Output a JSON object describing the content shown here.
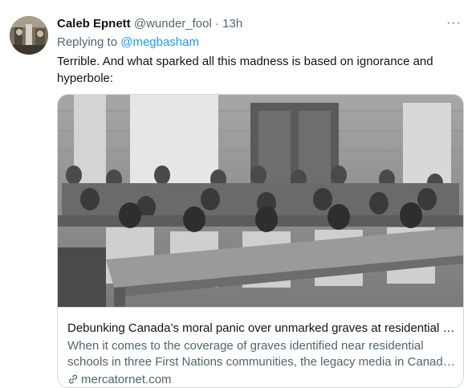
{
  "tweet": {
    "author_name": "Caleb Epnett",
    "handle": "@wunder_fool",
    "separator": "·",
    "time": "13h",
    "more_label": "···",
    "replying_prefix": "Replying to",
    "replying_to": "@megbasham",
    "text": "Terrible. And what sparked all this madness is based on ignorance and hyperbole:"
  },
  "card": {
    "title": "Debunking Canada’s moral panic over unmarked graves at residential s...",
    "description_line1": "When it comes to the coverage of graves identified near residential",
    "description_line2": "schools in three First Nations communities, the legacy media in Canada...",
    "domain": "mercatornet.com"
  },
  "colors": {
    "text": "#0f1419",
    "secondary": "#536471",
    "link": "#1d9bf0",
    "border": "#cfd9de"
  },
  "icons": {
    "more": "more-horizontal-icon",
    "link": "link-icon"
  }
}
